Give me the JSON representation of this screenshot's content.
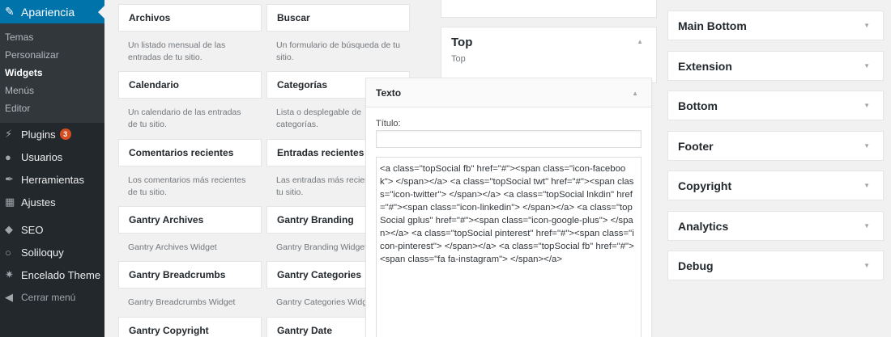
{
  "admin_menu": {
    "current_section": "Apariencia",
    "submenu": [
      "Temas",
      "Personalizar",
      "Widgets",
      "Menús",
      "Editor"
    ],
    "current_sub": "Widgets",
    "items": [
      {
        "label": "Plugins",
        "badge": "3",
        "icon": "plug-icon"
      },
      {
        "label": "Usuarios",
        "icon": "user-icon"
      },
      {
        "label": "Herramientas",
        "icon": "wrench-icon"
      },
      {
        "label": "Ajustes",
        "icon": "settings-icon"
      },
      {
        "label": "SEO",
        "icon": "seo-icon"
      },
      {
        "label": "Soliloquy",
        "icon": "soliloquy-icon"
      },
      {
        "label": "Encelado Theme",
        "icon": "gear-icon"
      }
    ],
    "collapse_label": "Cerrar menú"
  },
  "widgets": [
    {
      "title": "Archivos",
      "desc": "Un listado mensual de las entradas de tu sitio."
    },
    {
      "title": "Buscar",
      "desc": "Un formulario de búsqueda de tu sitio."
    },
    {
      "title": "Calendario",
      "desc": "Un calendario de las entradas de tu sitio."
    },
    {
      "title": "Categorías",
      "desc": "Lista o desplegable de categorías."
    },
    {
      "title": "Comentarios recientes",
      "desc": "Los comentarios más recientes de tu sitio."
    },
    {
      "title": "Entradas recientes",
      "desc": "Las entradas más recientes de tu sitio."
    },
    {
      "title": "Gantry Archives",
      "desc": "Gantry Archives Widget"
    },
    {
      "title": "Gantry Branding",
      "desc": "Gantry Branding Widget"
    },
    {
      "title": "Gantry Breadcrumbs",
      "desc": "Gantry Breadcrumbs Widget"
    },
    {
      "title": "Gantry Categories",
      "desc": "Gantry Categories Widget"
    },
    {
      "title": "Gantry Copyright",
      "desc": ""
    },
    {
      "title": "Gantry Date",
      "desc": ""
    }
  ],
  "top_pane": {
    "title": "Top",
    "subtitle": "Top"
  },
  "text_widget": {
    "title": "Texto",
    "field_label": "Título:",
    "title_value": "",
    "content": "<a class=\"topSocial fb\" href=\"#\"><span class=\"icon-facebook\"> </span></a> <a class=\"topSocial twt\" href=\"#\"><span class=\"icon-twitter\"> </span></a> <a class=\"topSocial lnkdin\" href=\"#\"><span class=\"icon-linkedin\"> </span></a> <a class=\"topSocial gplus\" href=\"#\"><span class=\"icon-google-plus\"> </span></a> <a class=\"topSocial pinterest\" href=\"#\"><span class=\"icon-pinterest\"> </span></a> <a class=\"topSocial fb\" href=\"#\"><span class=\"fa fa-instagram\"> </span></a>"
  },
  "widget_areas": [
    "Main Bottom",
    "Extension",
    "Bottom",
    "Footer",
    "Copyright",
    "Analytics",
    "Debug"
  ]
}
